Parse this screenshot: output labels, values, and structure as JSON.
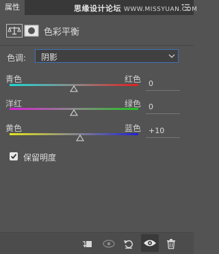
{
  "tab": {
    "label": "属性"
  },
  "watermark": {
    "text": "思缘设计论坛",
    "url": "WWW.MISSYUAN.COM"
  },
  "header": {
    "title": "色彩平衡"
  },
  "tone": {
    "label": "色调:",
    "value": "阴影"
  },
  "sliders": [
    {
      "left": "青色",
      "right": "红色",
      "value": "0",
      "level": 0
    },
    {
      "left": "洋红",
      "right": "绿色",
      "value": "0",
      "level": 0
    },
    {
      "left": "黄色",
      "right": "蓝色",
      "value": "+10",
      "level": 10
    }
  ],
  "preserve": {
    "label": "保留明度",
    "checked": true
  },
  "colors": {
    "accent": "#3f72b5",
    "panel": "#535353"
  }
}
